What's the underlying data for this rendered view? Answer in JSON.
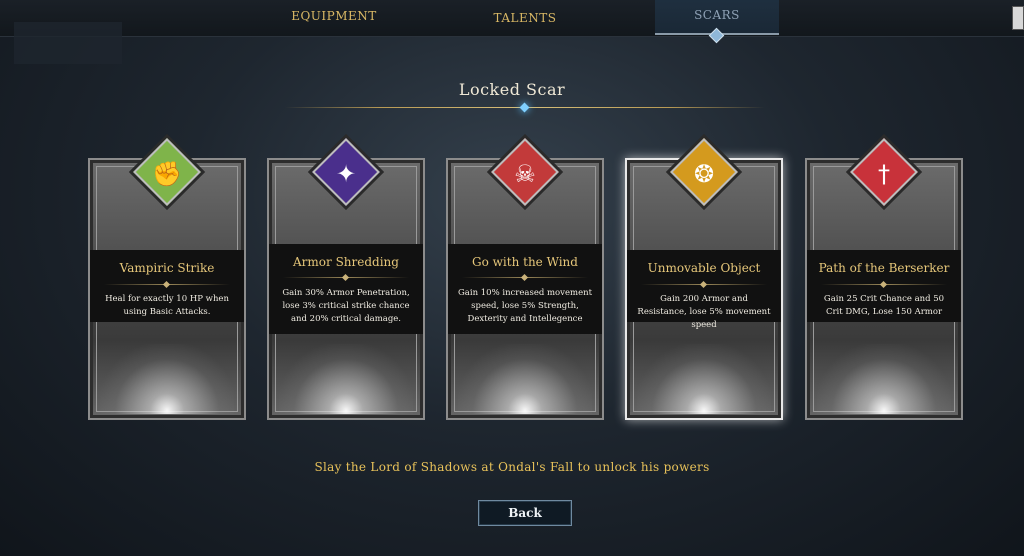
{
  "tabs": [
    {
      "label": "EQUIPMENT",
      "active": false
    },
    {
      "label": "TALENTS",
      "active": false
    },
    {
      "label": "SCARS",
      "active": true
    }
  ],
  "page_title": "Locked Scar",
  "cards": [
    {
      "name": "Vampiric Strike",
      "description": "Heal for exactly 10 HP when using Basic Attacks.",
      "icon": "clasped-hands-icon",
      "icon_color": "#7fb44a",
      "selected": false
    },
    {
      "name": "Armor Shredding",
      "description": "Gain 30% Armor Penetration, lose 3% critical strike chance and 20% critical damage.",
      "icon": "shredded-armor-icon",
      "icon_color": "#4a2f8c",
      "selected": false
    },
    {
      "name": "Go with the Wind",
      "description": "Gain 10% increased movement speed, lose 5% Strength, Dexterity and Intellegence",
      "icon": "running-figure-icon",
      "icon_color": "#c23a3a",
      "selected": false
    },
    {
      "name": "Unmovable Object",
      "description": "Gain 200 Armor and Resistance, lose 5% movement speed",
      "icon": "shield-emblem-icon",
      "icon_color": "#d49a1e",
      "selected": true
    },
    {
      "name": "Path of the Berserker",
      "description": "Gain 25 Crit Chance and 50 Crit DMG, Lose 150 Armor",
      "icon": "sword-icon",
      "icon_color": "#c8323a",
      "selected": false
    }
  ],
  "unlock_message": "Slay the Lord of Shadows at Ondal's Fall to unlock his powers",
  "back_button": "Back"
}
